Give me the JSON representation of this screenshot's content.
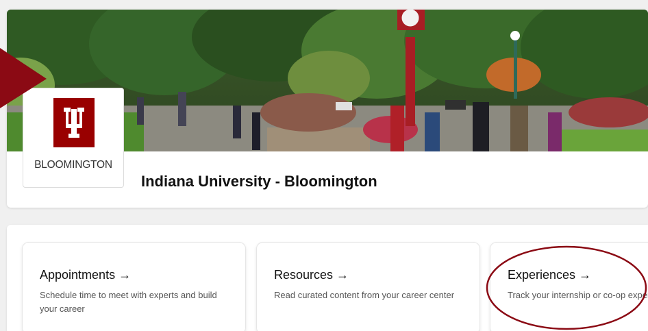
{
  "institution": {
    "logo_text": "BLOOMINGTON",
    "name": "Indiana University - Bloomington"
  },
  "cards": [
    {
      "title": "Appointments →",
      "description": "Schedule time to meet with experts and build your career"
    },
    {
      "title": "Resources →",
      "description": "Read curated content from your career center"
    },
    {
      "title": "Experiences →",
      "description": "Track your internship or co-op experiences"
    }
  ],
  "colors": {
    "brand": "#990000",
    "annotation": "#8b0a14",
    "card_border": "#e6e6e6"
  }
}
